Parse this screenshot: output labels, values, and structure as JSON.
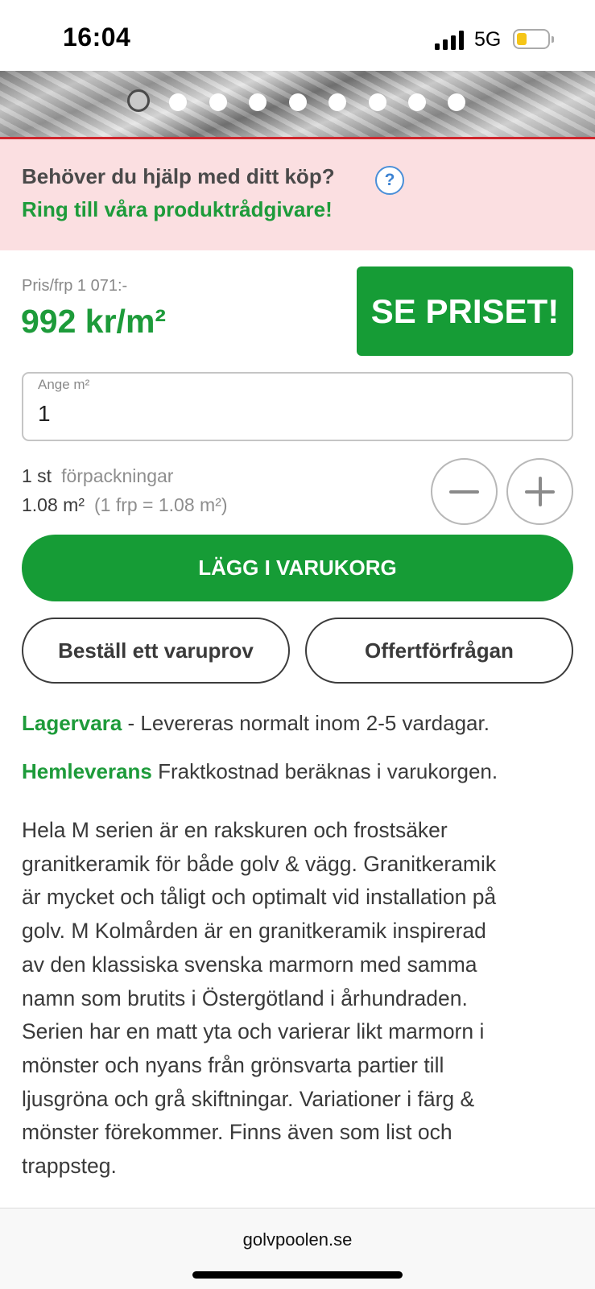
{
  "status_bar": {
    "time": "16:04",
    "network": "5G",
    "battery_color": "#f5c518"
  },
  "carousel": {
    "image_count": 9,
    "active_index": 0
  },
  "help_banner": {
    "question": "Behöver du hjälp med ditt köp?",
    "help_icon": "?",
    "call_text": "Ring till våra produktrådgivare!"
  },
  "pricing": {
    "package_price": "Pris/frp 1 071:-",
    "price_per_m2": "992 kr/m²",
    "see_price_button": "SE PRISET!"
  },
  "quantity_input": {
    "label": "Ange m²",
    "value": "1"
  },
  "packages": {
    "count": "1 st",
    "count_unit": "förpackningar",
    "area": "1.08 m²",
    "per_pack": "(1 frp = 1.08 m²)",
    "decrease_icon": "minus-icon",
    "increase_icon": "plus-icon"
  },
  "actions": {
    "add_to_cart": "LÄGG I VARUKORG",
    "order_sample": "Beställ ett varuprov",
    "quote_request": "Offertförfrågan"
  },
  "delivery": {
    "stock_label": "Lagervara",
    "stock_text": " - Levereras normalt inom 2-5 vardagar.",
    "home_label": "Hemleverans",
    "home_text": " Fraktkostnad beräknas i varukorgen."
  },
  "description_lines": [
    "Hela M serien är en rakskuren och frostsäker",
    "granitkeramik för både golv & vägg. Granitkeramik",
    "är mycket och tåligt och optimalt vid installation på",
    "golv. M Kolmården är en granitkeramik inspirerad",
    "av den klassiska svenska marmorn med samma",
    "namn som brutits i Östergötland i århundraden.",
    "Serien har en matt yta och varierar likt marmorn i",
    "mönster och nyans från grönsvarta partier till",
    "ljusgröna och grå skiftningar. Variationer i färg &",
    "mönster förekommer. Finns även som list och",
    "trappsteg."
  ],
  "browser": {
    "url": "golvpoolen.se"
  },
  "colors": {
    "brand_green": "#169c36",
    "text_green": "#1d9b3a",
    "banner_pink": "#fbdfe1",
    "accent_red": "#d0262d"
  }
}
